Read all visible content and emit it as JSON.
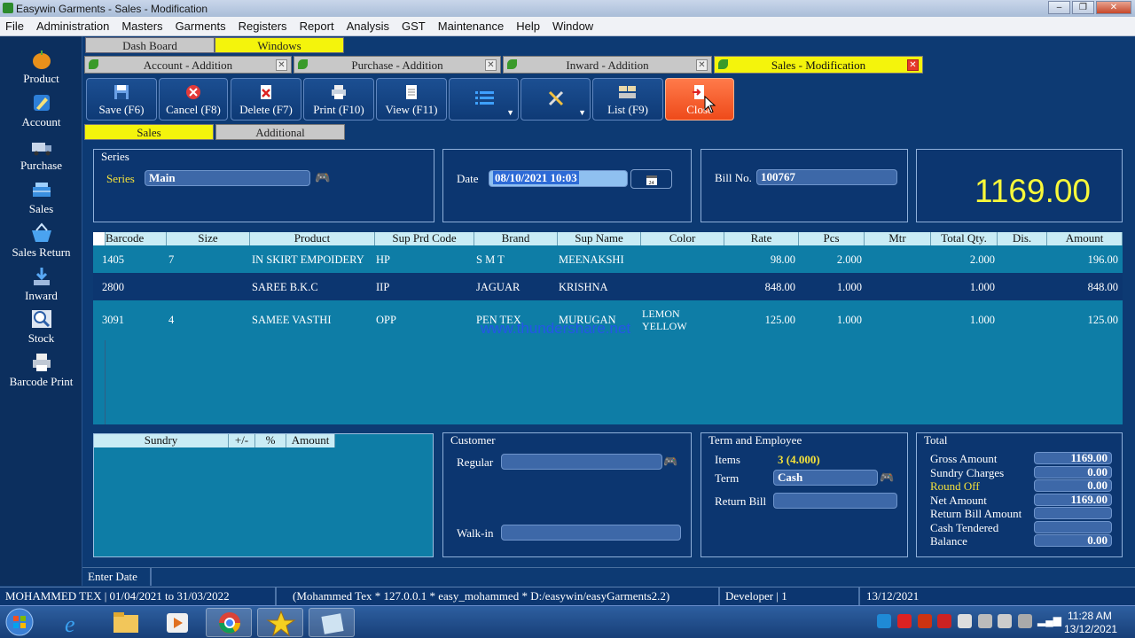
{
  "window": {
    "title": "Easywin Garments - Sales - Modification"
  },
  "menu": [
    "File",
    "Administration",
    "Masters",
    "Garments",
    "Registers",
    "Report",
    "Analysis",
    "GST",
    "Maintenance",
    "Help",
    "Window"
  ],
  "sidebar": [
    {
      "label": "Product",
      "icon": "apple-icon"
    },
    {
      "label": "Account",
      "icon": "pen-icon"
    },
    {
      "label": "Purchase",
      "icon": "truck-icon"
    },
    {
      "label": "Sales",
      "icon": "sales-icon"
    },
    {
      "label": "Sales Return",
      "icon": "basket-icon"
    },
    {
      "label": "Inward",
      "icon": "download-icon"
    },
    {
      "label": "Stock",
      "icon": "magnifier-icon"
    },
    {
      "label": "Barcode Print",
      "icon": "printer-icon"
    }
  ],
  "top_tabs": {
    "dashboard": "Dash Board",
    "windows": "Windows"
  },
  "doc_tabs": [
    "Account - Addition",
    "Purchase - Addition",
    "Inward - Addition",
    "Sales - Modification"
  ],
  "toolbar": {
    "save": "Save (F6)",
    "cancel": "Cancel (F8)",
    "delete": "Delete (F7)",
    "print": "Print (F10)",
    "view": "View (F11)",
    "list": "List (F9)",
    "close": "Close"
  },
  "subtabs": {
    "sales": "Sales",
    "additional": "Additional"
  },
  "series": {
    "group_label": "Series",
    "label": "Series",
    "value": "Main"
  },
  "date": {
    "label": "Date",
    "value": "08/10/2021 10:03"
  },
  "bill": {
    "label": "Bill No.",
    "value": "100767"
  },
  "grand_total": "1169.00",
  "grid": {
    "headers": [
      "Barcode",
      "Size",
      "Product",
      "Sup Prd Code",
      "Brand",
      "Sup Name",
      "Color",
      "Rate",
      "Pcs",
      "Mtr",
      "Total Qty.",
      "Dis.",
      "Amount"
    ],
    "rows": [
      {
        "barcode": "1405",
        "size": "7",
        "product": "IN SKIRT EMPOIDERY",
        "sup_code": "HP",
        "brand": "S M T",
        "sup_name": "MEENAKSHI",
        "color": "",
        "rate": "98.00",
        "pcs": "2.000",
        "mtr": "",
        "total_qty": "2.000",
        "dis": "",
        "amount": "196.00"
      },
      {
        "barcode": "2800",
        "size": "",
        "product": "SAREE  B.K.C",
        "sup_code": "IIP",
        "brand": "JAGUAR",
        "sup_name": "KRISHNA",
        "color": "",
        "rate": "848.00",
        "pcs": "1.000",
        "mtr": "",
        "total_qty": "1.000",
        "dis": "",
        "amount": "848.00"
      },
      {
        "barcode": "3091",
        "size": "4",
        "product": "SAMEE VASTHI",
        "sup_code": "OPP",
        "brand": "PEN TEX",
        "sup_name": "MURUGAN",
        "color": "LEMON YELLOW",
        "rate": "125.00",
        "pcs": "1.000",
        "mtr": "",
        "total_qty": "1.000",
        "dis": "",
        "amount": "125.00"
      }
    ]
  },
  "watermark": "www.thundershare.net",
  "sundry": {
    "headers": [
      "Sundry",
      "+/-",
      "%",
      "Amount"
    ]
  },
  "customer": {
    "title": "Customer",
    "regular_label": "Regular",
    "regular_value": "",
    "walkin_label": "Walk-in",
    "walkin_value": ""
  },
  "term": {
    "title": "Term and Employee",
    "items_label": "Items",
    "items_value": "3 (4.000)",
    "term_label": "Term",
    "term_value": "Cash",
    "return_label": "Return Bill",
    "return_value": ""
  },
  "total": {
    "title": "Total",
    "rows": [
      {
        "label": "Gross Amount",
        "value": "1169.00"
      },
      {
        "label": "Sundry Charges",
        "value": "0.00"
      },
      {
        "label": "Round Off",
        "value": "0.00"
      },
      {
        "label": "Net Amount",
        "value": "1169.00"
      },
      {
        "label": "Return Bill Amount",
        "value": ""
      },
      {
        "label": "Cash Tendered",
        "value": ""
      },
      {
        "label": "Balance",
        "value": "0.00"
      }
    ]
  },
  "status": {
    "hint": "Enter Date",
    "company": "MOHAMMED TEX | 01/04/2021 to 31/03/2022",
    "connection": "(Mohammed Tex * 127.0.0.1 * easy_mohammed * D:/easywin/easyGarments2.2)",
    "user": "Developer | 1",
    "date": "13/12/2021"
  },
  "taskbar": {
    "time": "11:28 AM",
    "date": "13/12/2021"
  },
  "colors": {
    "accent_yellow": "#f4f40c",
    "background": "#0d3a73",
    "grid": "#0e7da6",
    "close": "#ee4a1a"
  }
}
